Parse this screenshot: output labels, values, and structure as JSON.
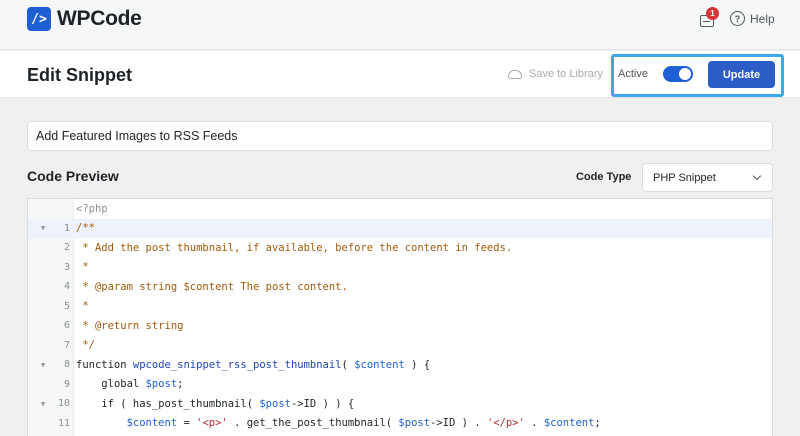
{
  "app": {
    "name": "WPCode",
    "logo_glyph": "/>"
  },
  "topbar": {
    "notification_count": "1",
    "help_label": "Help"
  },
  "header": {
    "title": "Edit Snippet",
    "save_to_library": "Save to Library",
    "active_label": "Active",
    "active_toggle": true,
    "update_label": "Update"
  },
  "snippet": {
    "title_value": "Add Featured Images to RSS Feeds",
    "section_title": "Code Preview",
    "code_type_label": "Code Type",
    "code_type_value": "PHP Snippet"
  },
  "code": {
    "preamble": "<?php",
    "lines": [
      {
        "num": "1",
        "fold": true,
        "text": "/**"
      },
      {
        "num": "2",
        "fold": false,
        "text": " * Add the post thumbnail, if available, before the content in feeds."
      },
      {
        "num": "3",
        "fold": false,
        "text": " *"
      },
      {
        "num": "4",
        "fold": false,
        "text": " * @param string $content The post content."
      },
      {
        "num": "5",
        "fold": false,
        "text": " *"
      },
      {
        "num": "6",
        "fold": false,
        "text": " * @return string"
      },
      {
        "num": "7",
        "fold": false,
        "text": " */"
      },
      {
        "num": "8",
        "fold": true,
        "text": "function wpcode_snippet_rss_post_thumbnail( $content ) {"
      },
      {
        "num": "9",
        "fold": false,
        "text": "    global $post;"
      },
      {
        "num": "10",
        "fold": true,
        "text": "    if ( has_post_thumbnail( $post->ID ) ) {"
      },
      {
        "num": "11",
        "fold": false,
        "text": "        $content = '<p>' . get_the_post_thumbnail( $post->ID ) . '</p>' . $content;"
      }
    ]
  },
  "colors": {
    "brand": "#1f5fd6",
    "update_button": "#2c5cc5",
    "highlight": "#3da8e8",
    "badge": "#d63638"
  }
}
